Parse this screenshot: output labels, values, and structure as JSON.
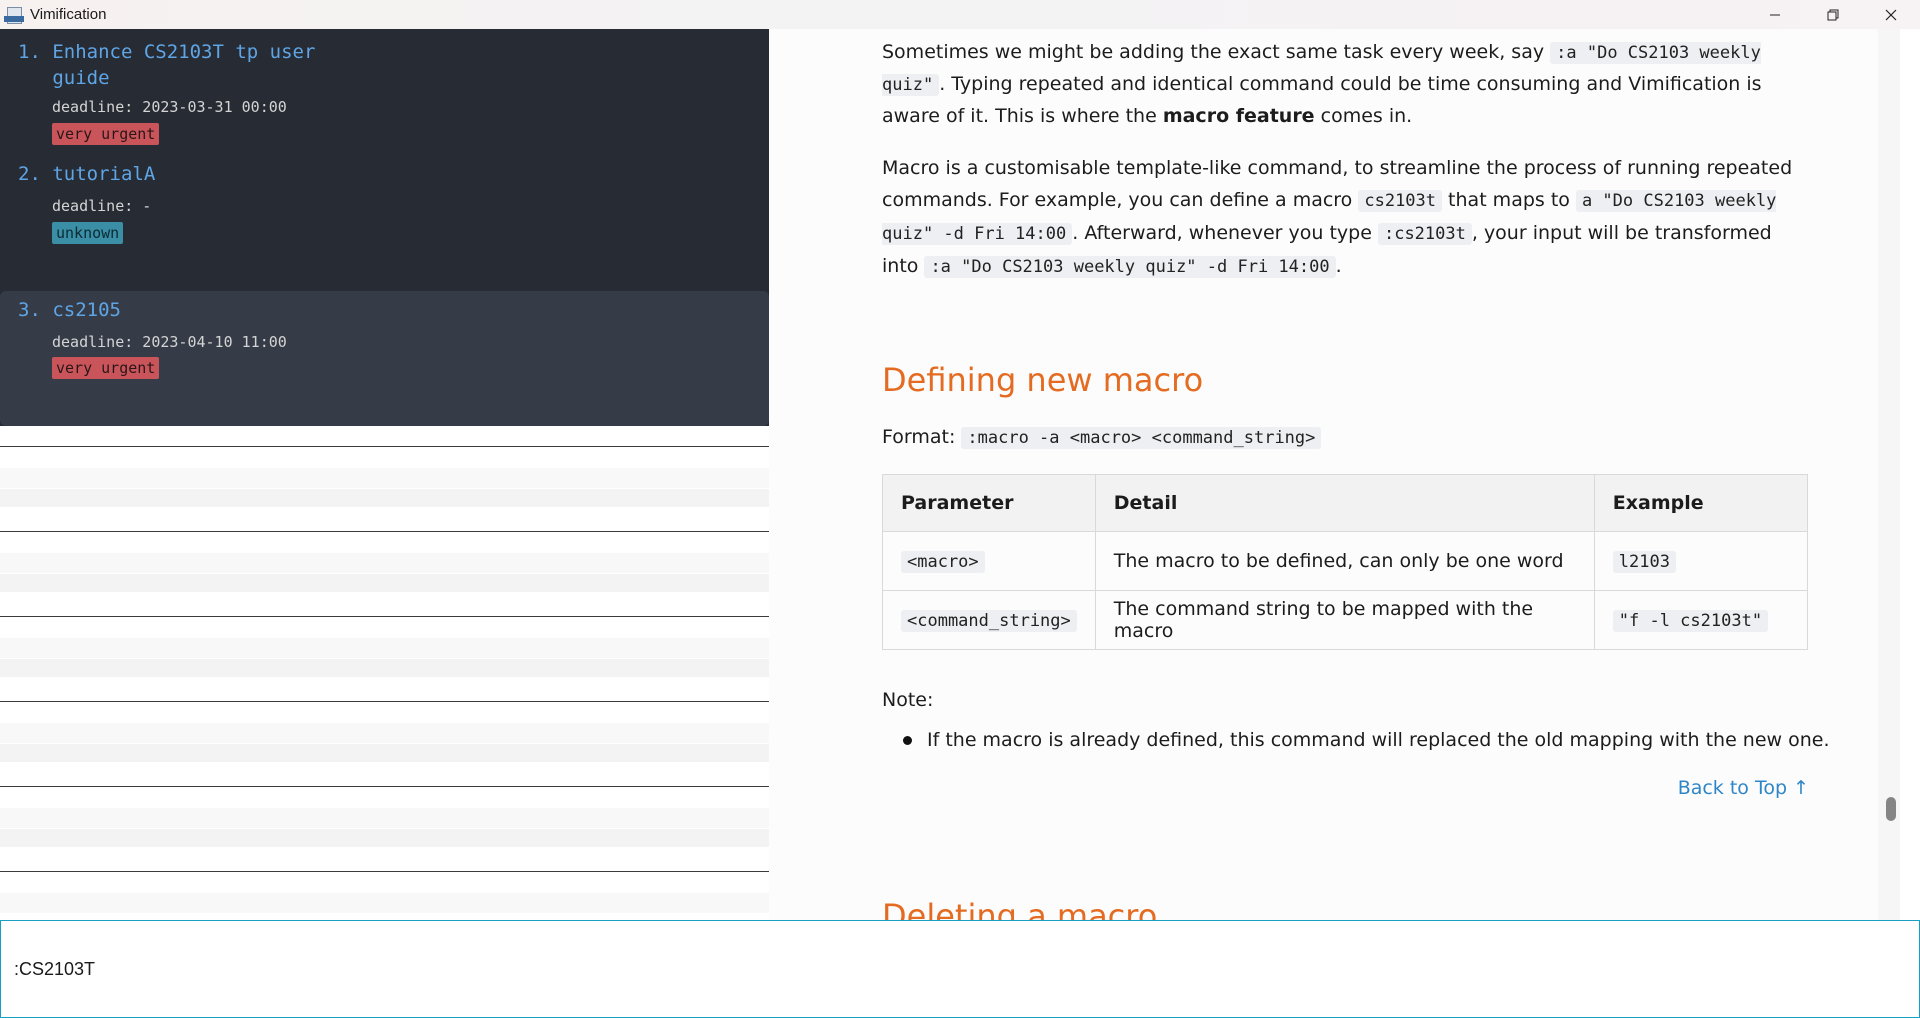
{
  "window": {
    "title": "Vimification"
  },
  "tasks": [
    {
      "title_line1": "1. Enhance CS2103T tp user",
      "title_line2": "   guide",
      "deadline": "deadline: 2023-03-31 00:00",
      "badge": "very urgent",
      "badge_type": "urgent"
    },
    {
      "title_line1": "2. tutorialA",
      "deadline": "deadline: -",
      "badge": "unknown",
      "badge_type": "unknown"
    },
    {
      "title_line1": "3. cs2105",
      "deadline": "deadline: 2023-04-10 11:00",
      "badge": "very urgent",
      "badge_type": "urgent",
      "selected": true
    }
  ],
  "doc": {
    "p1": {
      "t1": "Sometimes we might be adding the exact same task every week, say ",
      "c1": ":a \"Do CS2103 weekly quiz\"",
      "t2": ". Typing repeated and identical command could be time consuming and Vimification is aware of it. This is where the ",
      "b1": "macro feature",
      "t3": " comes in."
    },
    "p2": {
      "t1": "Macro is a customisable template-like command, to streamline the process of running repeated commands. For example, you can define a macro ",
      "c1": "cs2103t",
      "t2": " that maps to ",
      "c2": "a \"Do CS2103 weekly quiz\" -d Fri 14:00",
      "t3": ". Afterward, whenever you type ",
      "c3": ":cs2103t",
      "t4": ", your input will be transformed into ",
      "c4": ":a \"Do CS2103 weekly quiz\" -d Fri 14:00",
      "t5": "."
    },
    "heading_define": "Defining new macro",
    "format_label": "Format: ",
    "format_code": ":macro -a <macro> <command_string>",
    "table": {
      "headers": [
        "Parameter",
        "Detail",
        "Example"
      ],
      "rows": [
        [
          "<macro>",
          "The macro to be defined, can only be one word",
          "l2103"
        ],
        [
          "<command_string>",
          "The command string to be mapped with the macro",
          "\"f -l cs2103t\""
        ]
      ]
    },
    "note_label": "Note:",
    "note_item": "If the macro is already defined, this command will replaced the old mapping with the new one.",
    "back_to_top": "Back to Top ↑",
    "heading_delete": "Deleting a macro"
  },
  "command": {
    "value": ":CS2103T"
  },
  "colors": {
    "accent_heading": "#e46c22",
    "task_title": "#5fa5e6",
    "urgent": "#c9555b",
    "unknown": "#3a8fa6",
    "command_border": "#18a0c4",
    "link": "#2e86c8"
  }
}
